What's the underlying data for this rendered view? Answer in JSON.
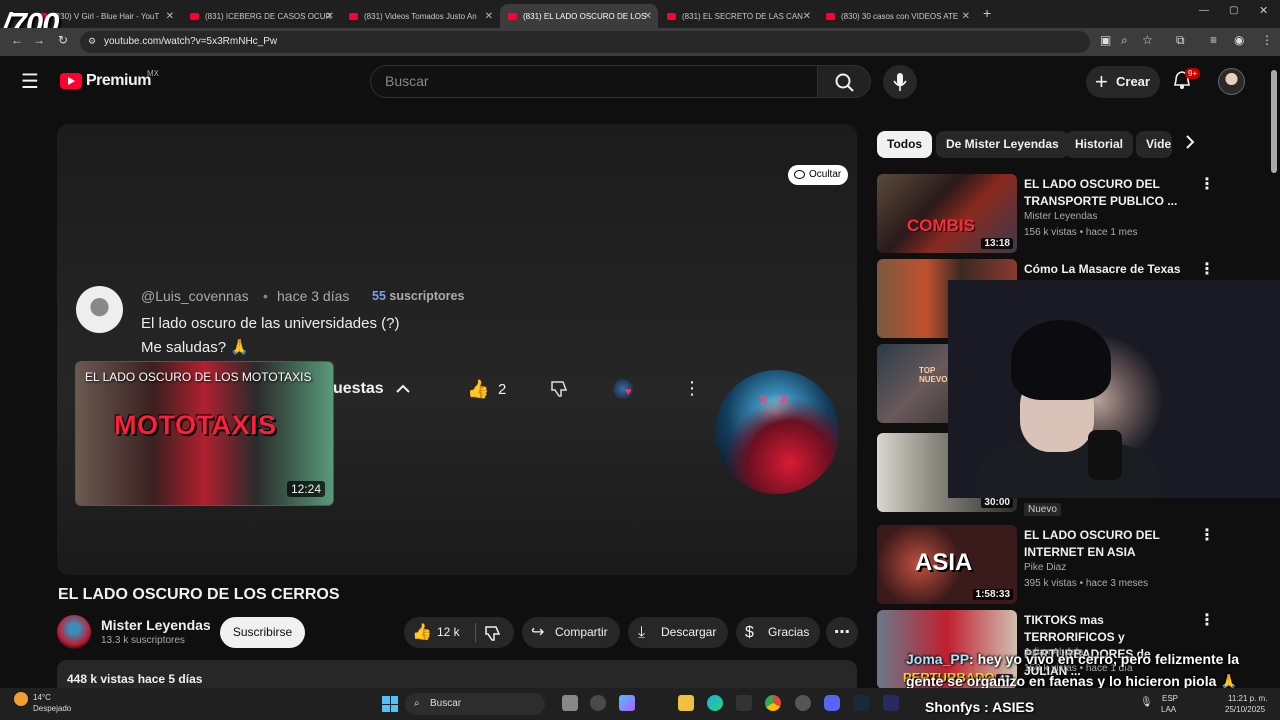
{
  "overlay_counter": "/700",
  "tabs": [
    {
      "label": "(830) V Girl - Blue Hair - YouT"
    },
    {
      "label": "(831) ICEBERG DE CASOS OCUR"
    },
    {
      "label": "(831) Videos Tomados Justo An"
    },
    {
      "label": "(831) EL LADO OSCURO DE LOS"
    },
    {
      "label": "(831) EL SECRETO DE LAS CAN"
    },
    {
      "label": "(830) 30 casos con VIDEOS ATE"
    }
  ],
  "address_bar": {
    "url": "youtube.com/watch?v=5x3RmNHc_Pw"
  },
  "header": {
    "logo_text": "Premium",
    "country": "MX",
    "search_placeholder": "Buscar",
    "create_label": "Crear",
    "notification_count": "9+"
  },
  "player": {
    "hide_label": "Ocultar",
    "comment": {
      "user": "@Luis_covennas",
      "separator": "•",
      "time": "hace 3 días",
      "subs_count": "55",
      "subs_label": "suscriptores",
      "line1": "El lado oscuro de las universidades (?)",
      "line2": "Me saludas? 🙏",
      "replies_label": "uestas",
      "like_count": "2"
    },
    "card": {
      "title": "EL LADO OSCURO DE LOS MOTOTAXIS",
      "big_text": "MOTOTAXIS",
      "duration": "12:24"
    },
    "mask_text": "X X"
  },
  "video": {
    "title": "EL LADO OSCURO DE LOS CERROS",
    "channel": "Mister Leyendas",
    "channel_subs": "13.3 k suscriptores",
    "subscribe_label": "Suscribirse",
    "likes": "12 k",
    "share_label": "Compartir",
    "download_label": "Descargar",
    "thanks_label": "Gracias",
    "views_line": "448 k vistas  hace 5 días"
  },
  "sidebar": {
    "chips": [
      "Todos",
      "De Mister Leyendas",
      "Historial",
      "Vide"
    ],
    "recs": [
      {
        "title": "EL LADO OSCURO DEL TRANSPORTE PUBLICO ...",
        "channel": "Mister Leyendas",
        "meta": "156 k vistas • hace 1 mes",
        "duration": "13:18",
        "thumb_text": "COMBIS"
      },
      {
        "title": "Cómo La Masacre de Texas",
        "channel": "",
        "meta": "",
        "duration": "",
        "thumb_text": ""
      },
      {
        "title": "",
        "channel": "",
        "meta": "",
        "duration": "",
        "thumb_text": "TOP NUEVO"
      },
      {
        "title": "",
        "channel": "",
        "meta": "",
        "duration": "30:00",
        "thumb_text": ""
      },
      {
        "title": "EL LADO OSCURO DEL INTERNET EN ASIA",
        "channel": "Pike Diaz",
        "meta": "395 k vistas • hace 3 meses",
        "duration": "1:58:33",
        "thumb_text": "ASIA"
      },
      {
        "title": "TIKTOKS mas TERRORIFICOS y PERTURBADORES de JULIAN ...",
        "channel": "Julian Abdala",
        "meta": "150 k vistas • hace 1 día",
        "duration": "43",
        "thumb_text": "PERTURBADO"
      }
    ],
    "new_badge": "Nuevo"
  },
  "chat": {
    "user": "Joma_PP",
    "message": ": hey yo vivo en cerro, pero felizmente la gente se organizo en faenas y lo hicieron piola 🙏"
  },
  "taskbar": {
    "temp": "14°C",
    "weather": "Despejado",
    "search": "Buscar",
    "bar_text": "Shonfys : ASIES",
    "lang1": "ESP",
    "lang2": "LAA",
    "time": "11:21 p. m.",
    "date": "25/10/2025"
  },
  "colors": {
    "accent": "#ff0033",
    "bg": "#0f0f0f"
  }
}
